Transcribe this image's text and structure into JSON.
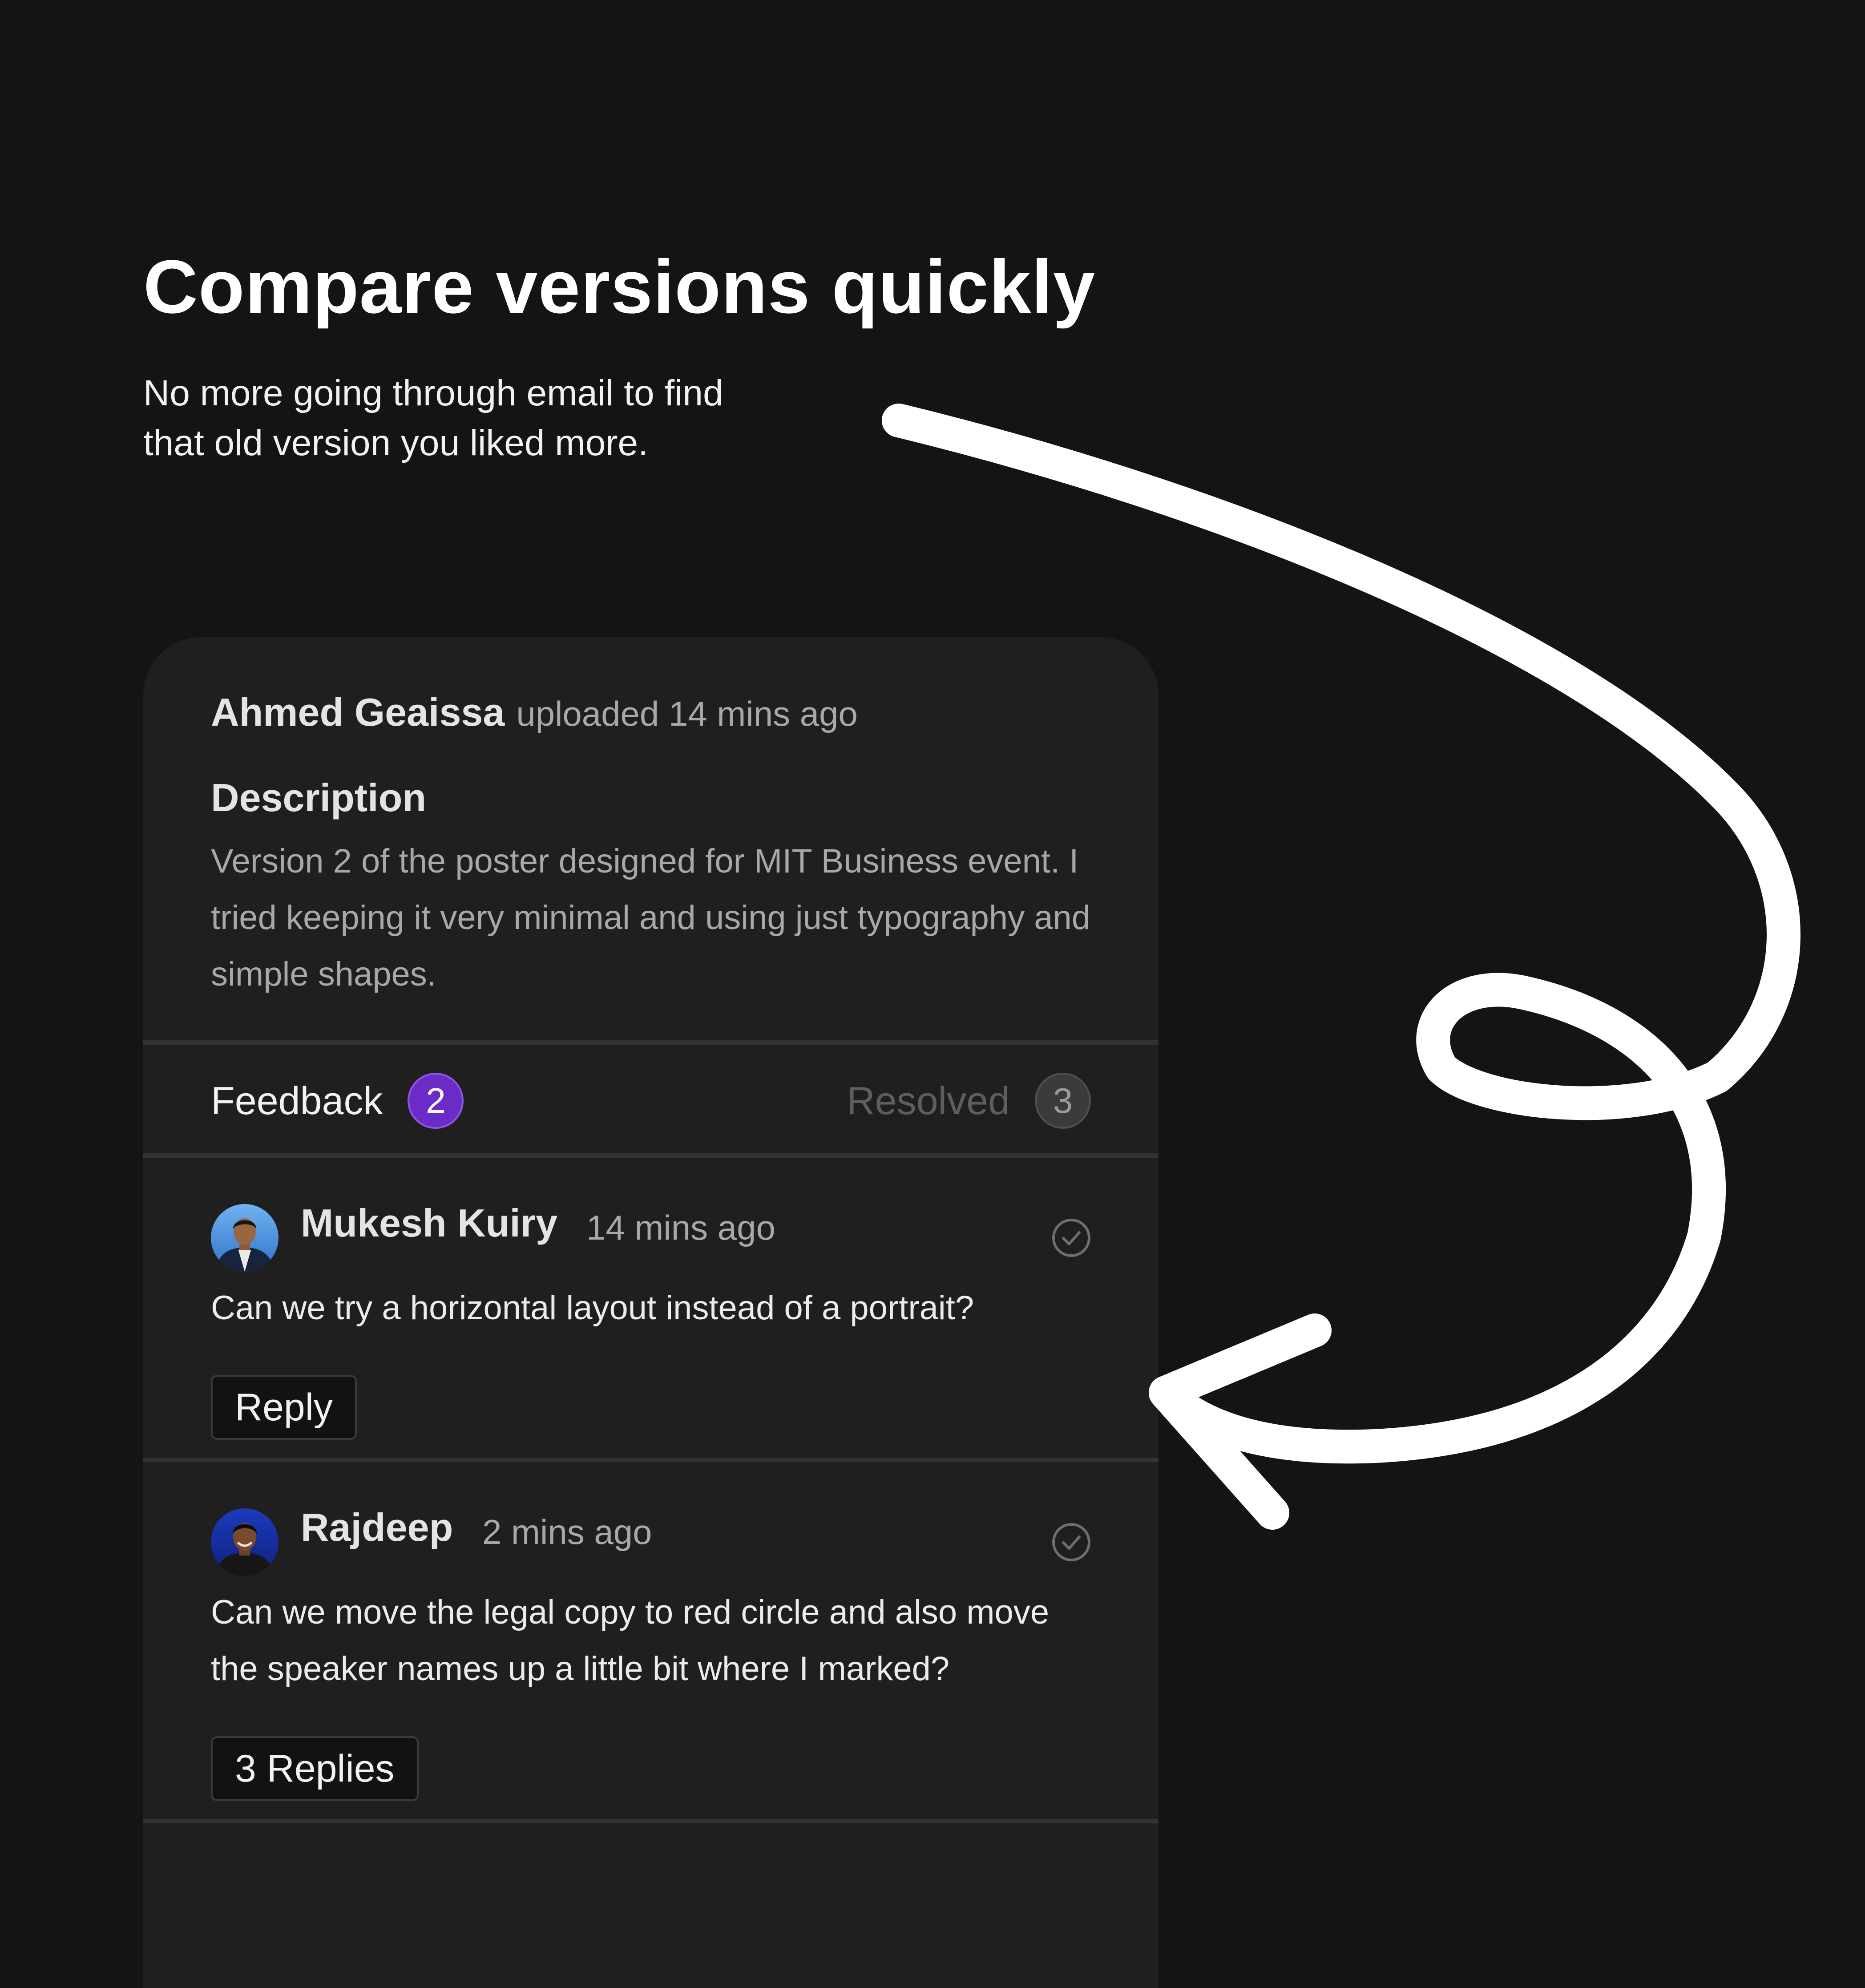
{
  "hero": {
    "title": "Compare versions quickly",
    "subtitle_line1": "No more going through email to find",
    "subtitle_line2": "that old version you liked more."
  },
  "upload": {
    "author": "Ahmed Geaissa",
    "meta": "uploaded 14 mins ago",
    "description_heading": "Description",
    "description_text": "Version 2 of the poster designed for MIT Business event. I tried keeping it very minimal and using just typography and simple shapes."
  },
  "tabs": {
    "feedback_label": "Feedback",
    "feedback_count": "2",
    "resolved_label": "Resolved",
    "resolved_count": "3"
  },
  "comments": [
    {
      "author": "Mukesh Kuiry",
      "time": "14 mins ago",
      "text": "Can we try a horizontal layout instead of a portrait?",
      "button_label": "Reply"
    },
    {
      "author": "Rajdeep",
      "time": "2 mins ago",
      "text": "Can we move the legal copy to red circle and also move the speaker names up a little bit where I marked?",
      "button_label": "3 Replies"
    }
  ],
  "colors": {
    "background": "#141414",
    "card": "#1f1f1f",
    "accent_purple": "#6a2bc7",
    "arrow": "#ffffff"
  },
  "icons": {
    "resolve": "check-circle-icon",
    "annotation": "hand-drawn-arrow"
  }
}
